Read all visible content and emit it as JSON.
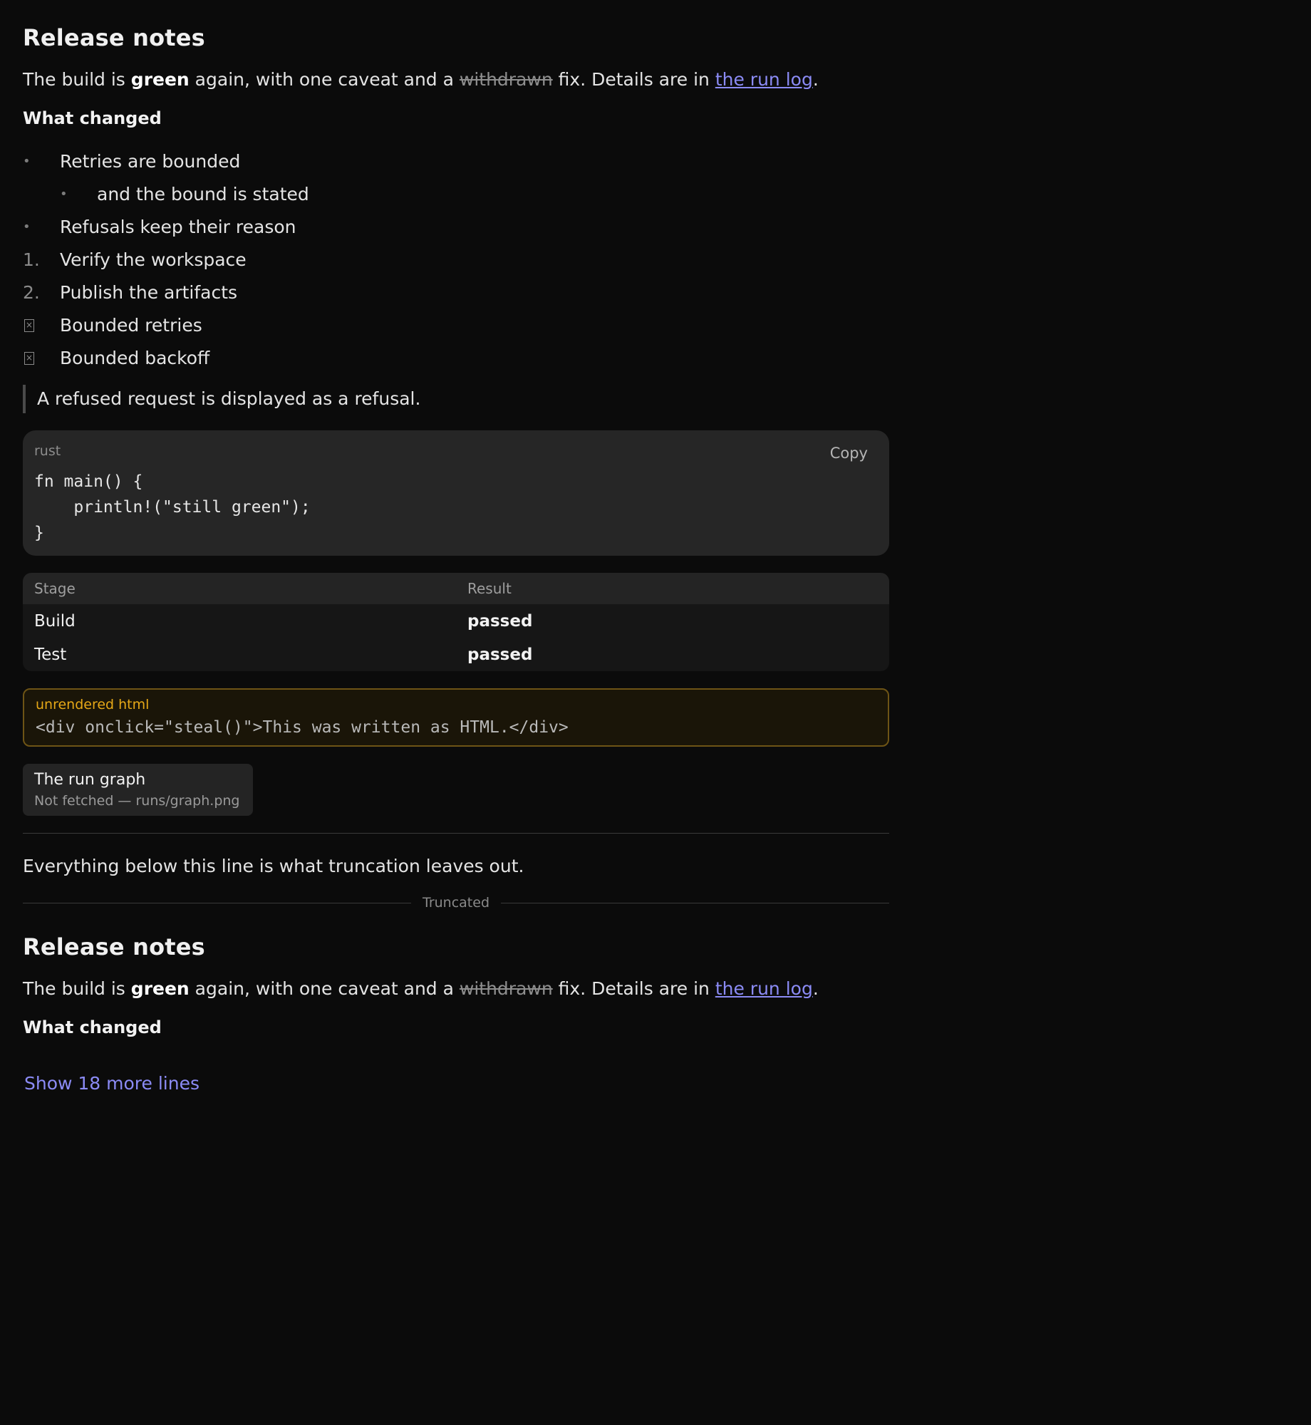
{
  "doc": {
    "title": "Release notes",
    "intro": {
      "part1": "The build is ",
      "bold": "green",
      "part2": " again, with one caveat and a ",
      "strike": "withdrawn",
      "part3": " fix. Details are in ",
      "link": "the run log",
      "part4": "."
    },
    "section_heading": "What changed",
    "bullets": [
      {
        "label": "Retries are bounded",
        "child": "and the bound is stated"
      },
      {
        "label": "Refusals keep their reason"
      }
    ],
    "bullet_marker": "•",
    "ordered": [
      {
        "marker": "1.",
        "label": "Verify the workspace"
      },
      {
        "marker": "2.",
        "label": "Publish the artifacts"
      }
    ],
    "tasks": [
      {
        "label": "Bounded retries"
      },
      {
        "label": "Bounded backoff"
      }
    ],
    "quote": "A refused request is displayed as a refusal.",
    "code": {
      "lang": "rust",
      "copy_label": "Copy",
      "source": "fn main() {\n    println!(\"still green\");\n}"
    },
    "table": {
      "headers": [
        "Stage",
        "Result"
      ],
      "rows": [
        [
          "Build",
          "passed"
        ],
        [
          "Test",
          "passed"
        ]
      ]
    },
    "unrendered": {
      "label": "unrendered html",
      "code": "<div onclick=\"steal()\">This was written as HTML.</div>"
    },
    "image": {
      "title": "The run graph",
      "status": "Not fetched — runs/graph.png"
    },
    "after_rule": "Everything below this line is what truncation leaves out."
  },
  "truncation": {
    "label": "Truncated",
    "show_more": "Show 18 more lines"
  },
  "colors": {
    "background": "#0b0b0b",
    "link": "#8b8bf5",
    "warning": "#e6a817"
  }
}
